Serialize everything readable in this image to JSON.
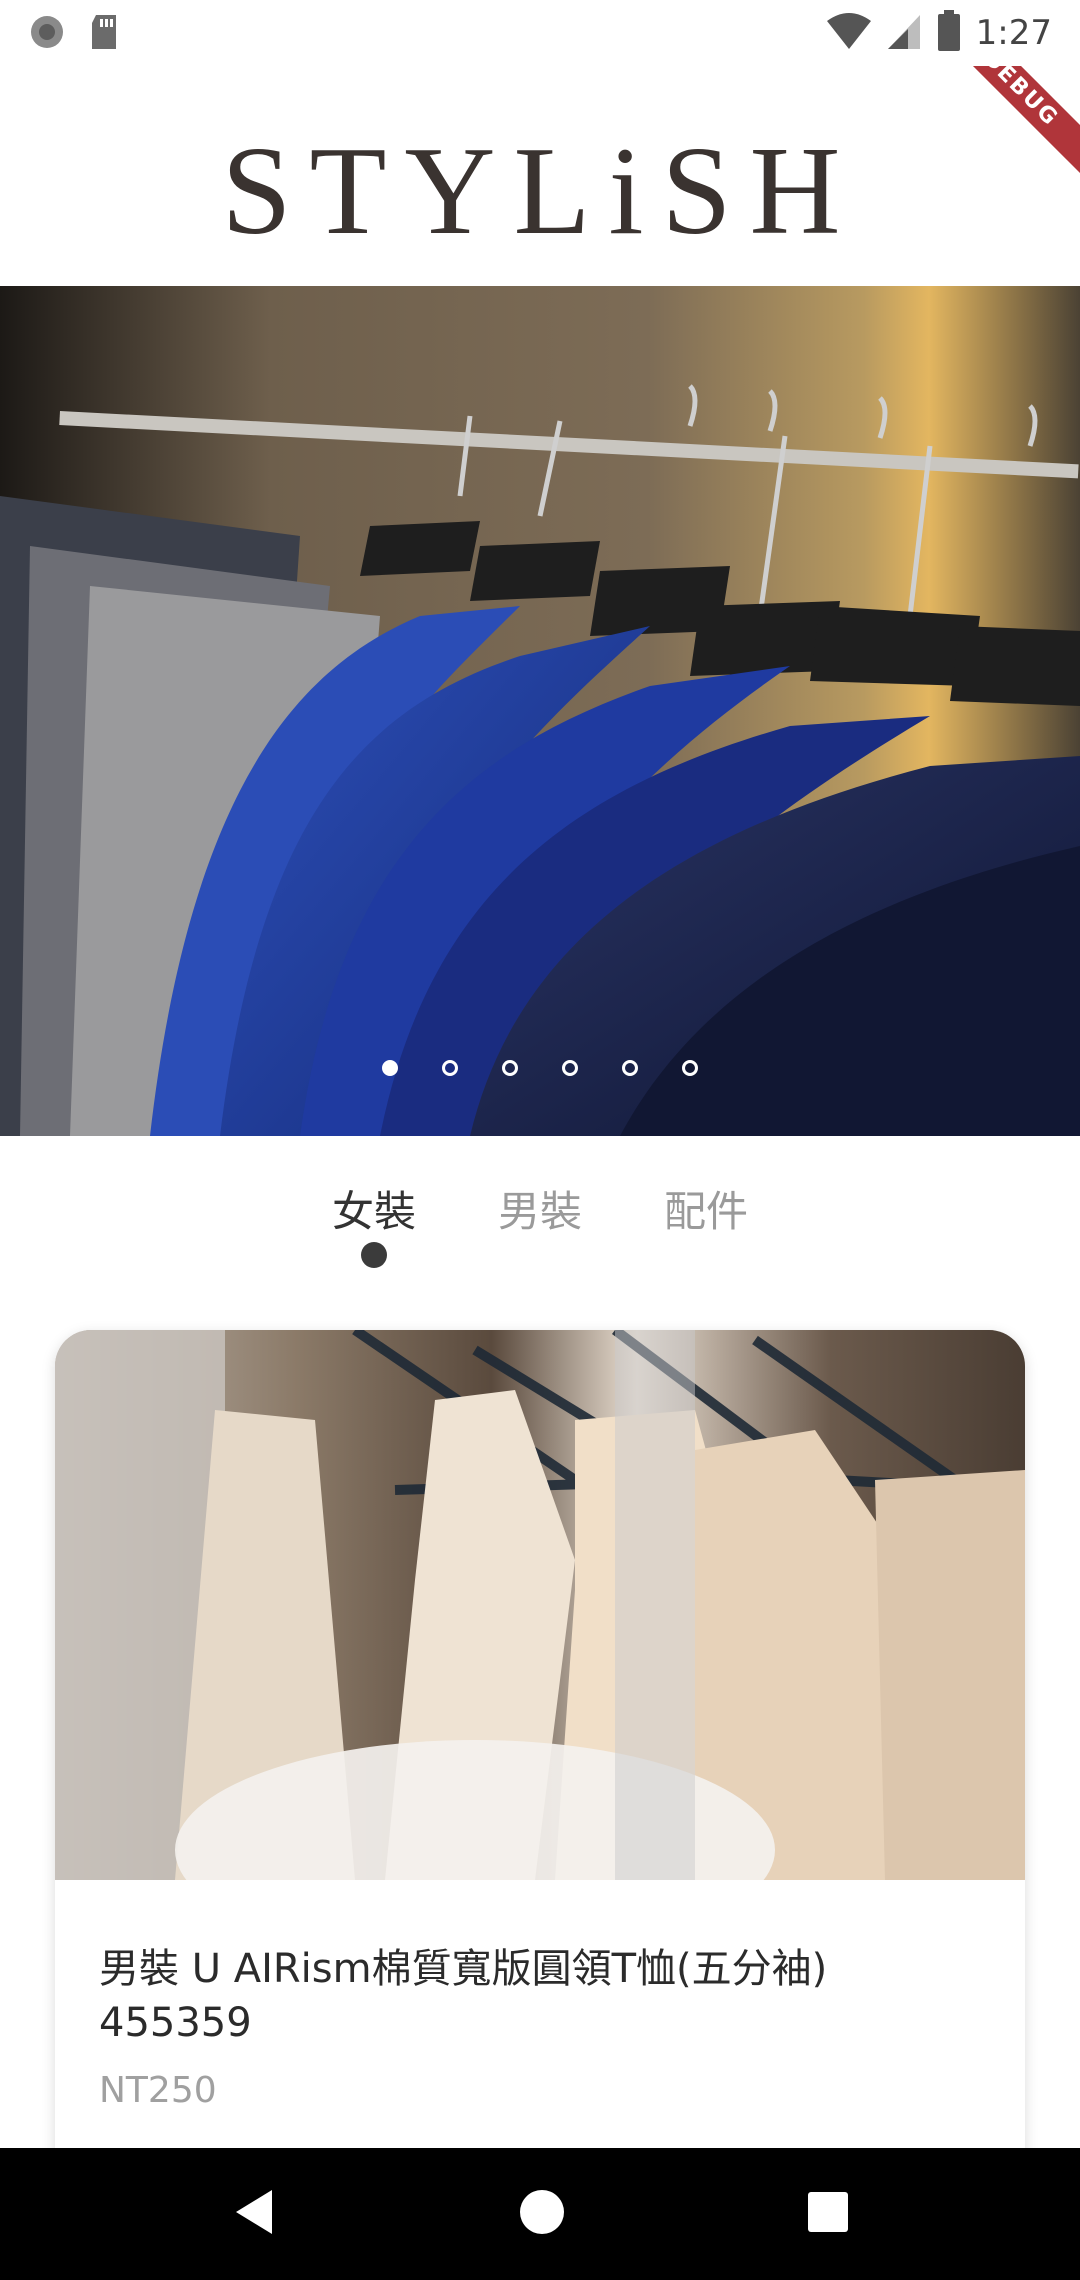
{
  "status_bar": {
    "time": "1:27",
    "icons": [
      "notification-dot-icon",
      "sd-card-icon",
      "wifi-icon",
      "signal-icon",
      "battery-icon"
    ]
  },
  "header": {
    "logo_text": "STYLiSH",
    "debug_label": "DEBUG"
  },
  "hero": {
    "image": "clothes-rack-blue-suits",
    "dots_total": 6,
    "active_index": 0
  },
  "tabs": [
    {
      "label": "女裝",
      "active": true
    },
    {
      "label": "男裝",
      "active": false
    },
    {
      "label": "配件",
      "active": false
    }
  ],
  "product": {
    "image": "dresses-on-hangers",
    "title": "男裝 U AIRism棉質寬版圓領T恤(五分袖)\n455359",
    "price": "NT250"
  },
  "nav_bar": {
    "buttons": [
      "back-icon",
      "home-icon",
      "recents-icon"
    ]
  },
  "colors": {
    "logo": "#3a3330",
    "tab_active": "#333333",
    "tab_inactive": "#9a9a9a",
    "debug_ribbon": "#b0353a",
    "price": "#a0a0a0"
  }
}
